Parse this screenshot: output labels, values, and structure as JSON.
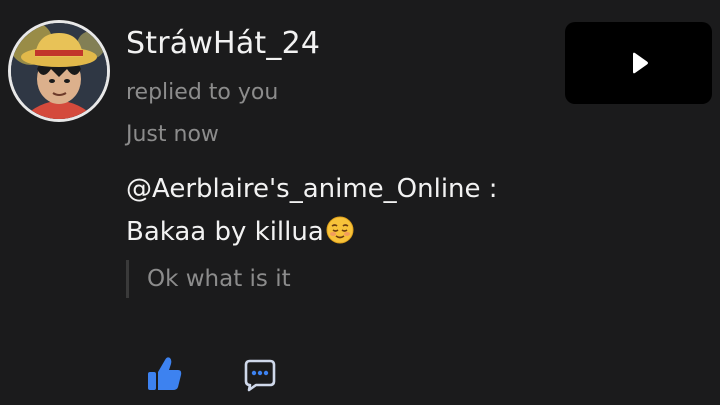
{
  "notification": {
    "username": "StráwHát_24",
    "action_text": "replied to you",
    "timestamp": "Just now",
    "comment_line1": "@Aerblaire's_anime_Online :",
    "comment_line2": "Bakaa by killua",
    "comment_emoji": "relieved-face-emoji",
    "quoted_text": "Ok what is it"
  },
  "actions": {
    "like_icon": "thumbs-up-icon",
    "reply_icon": "chat-bubble-icon"
  },
  "media": {
    "icon": "play-icon"
  },
  "colors": {
    "background": "#1b1b1c",
    "primary_text": "#f2f2f2",
    "secondary_text": "#8c8c8c",
    "like_blue": "#3d82f0",
    "video_bg": "#000000"
  }
}
